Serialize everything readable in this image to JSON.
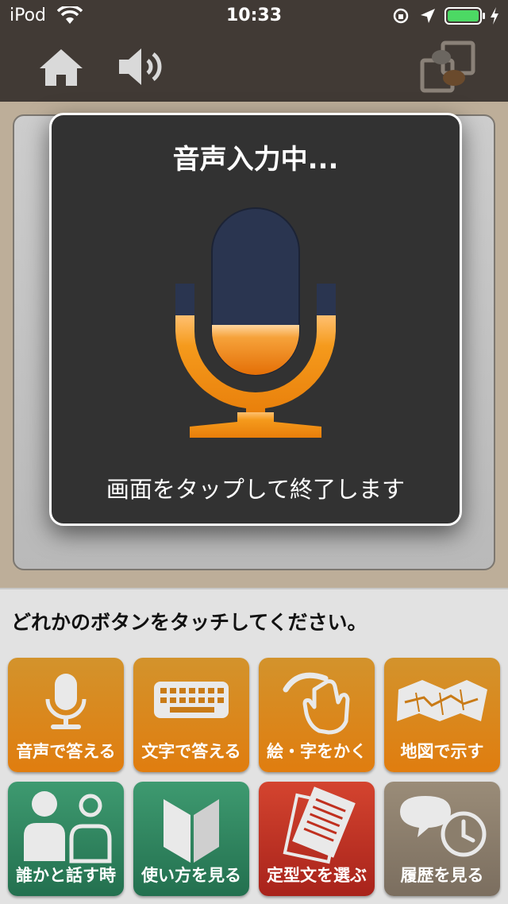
{
  "status_bar": {
    "carrier": "iPod",
    "time": "10:33"
  },
  "toolbar": {
    "home_icon": "home-icon",
    "sound_icon": "speaker-icon",
    "switch_icon": "chat-switch-icon"
  },
  "modal": {
    "title": "音声入力中...",
    "hint": "画面をタップして終了します",
    "mic_level": 0.3,
    "colors": {
      "mic_body": "#2a3550",
      "mic_fill": "#f08a10"
    }
  },
  "bottom": {
    "instruction": "どれかのボタンをタッチしてください。",
    "buttons": [
      {
        "label": "音声で答える",
        "icon": "microphone-icon"
      },
      {
        "label": "文字で答える",
        "icon": "keyboard-icon"
      },
      {
        "label": "絵・字をかく",
        "icon": "hand-draw-icon"
      },
      {
        "label": "地図で示す",
        "icon": "map-icon"
      },
      {
        "label": "誰かと話す時",
        "icon": "people-icon"
      },
      {
        "label": "使い方を見る",
        "icon": "book-icon"
      },
      {
        "label": "定型文を選ぶ",
        "icon": "document-icon"
      },
      {
        "label": "履歴を見る",
        "icon": "history-icon"
      }
    ]
  },
  "colors": {
    "orange": "#e08612",
    "green": "#2f8a60",
    "red": "#c0301f",
    "brown": "#8b7e6c",
    "dark": "#413a35"
  }
}
